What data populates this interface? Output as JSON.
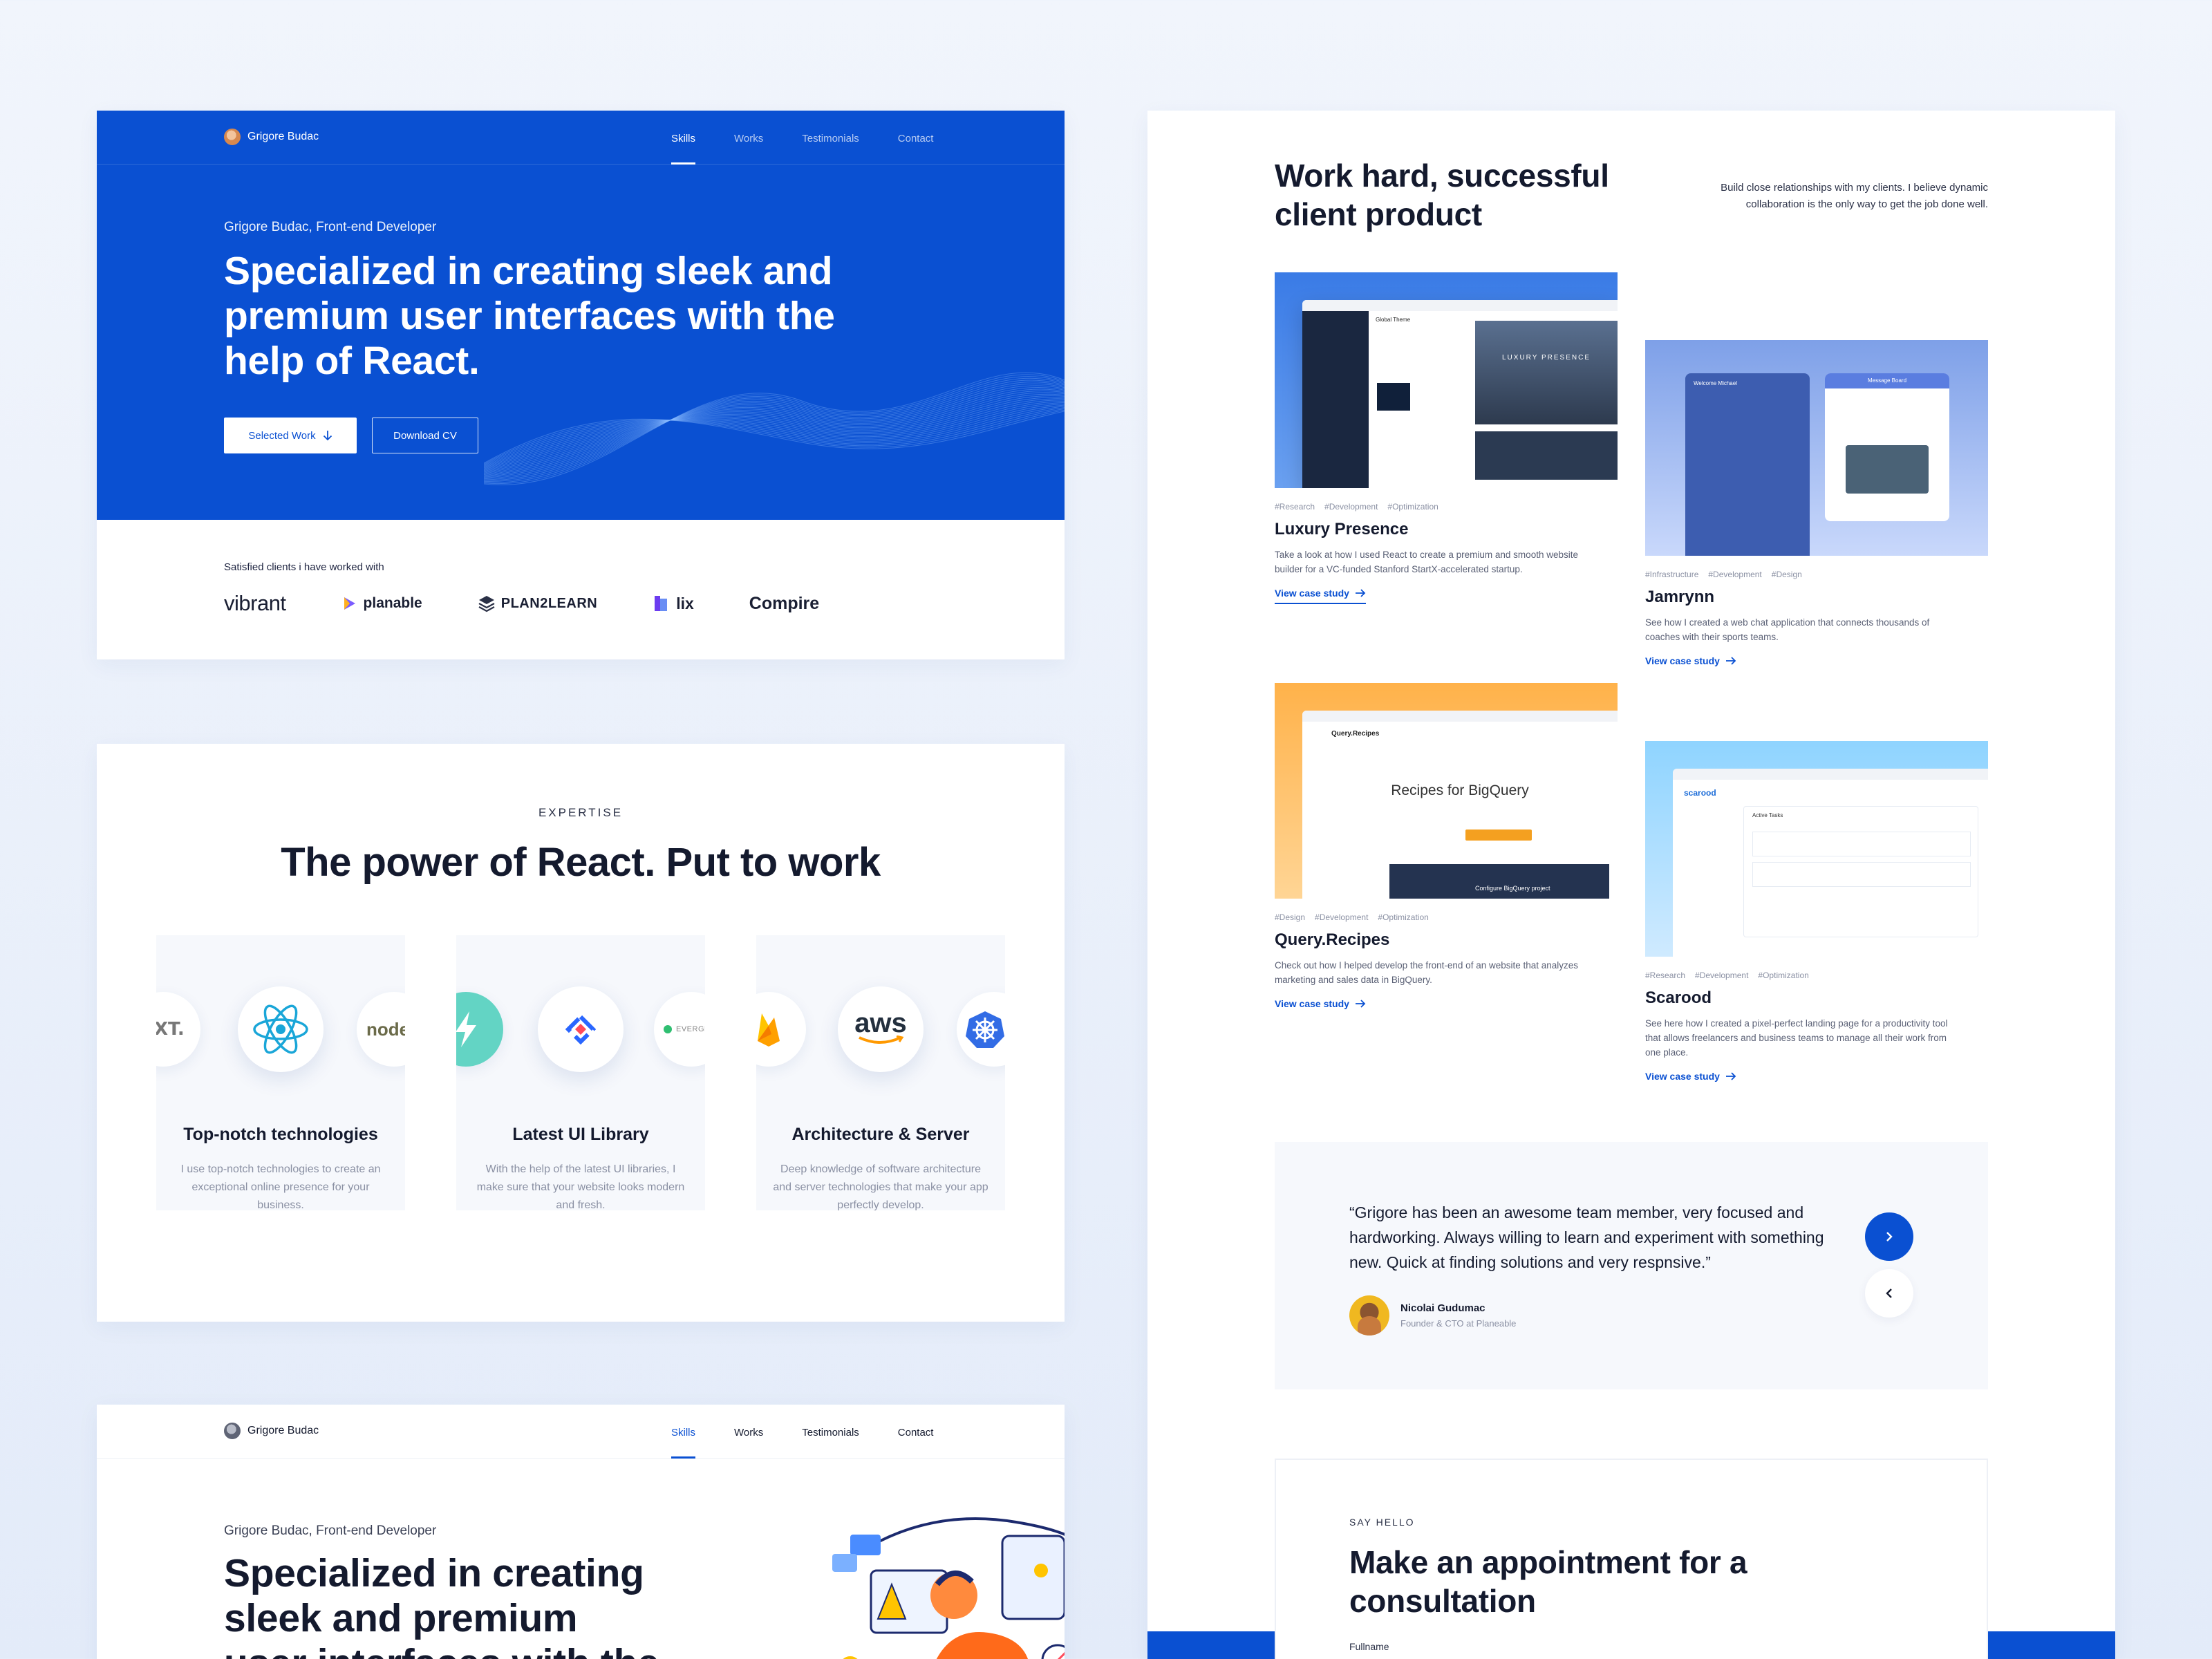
{
  "hero": {
    "brand": "Grigore Budac",
    "nav": [
      "Skills",
      "Works",
      "Testimonials",
      "Contact"
    ],
    "active_nav": "Skills",
    "subtitle": "Grigore Budac, Front-end Developer",
    "title": "Specialized in creating sleek and premium user interfaces with the help of React.",
    "btn_primary": "Selected Work",
    "btn_secondary": "Download CV",
    "clients_label": "Satisfied clients i have worked with",
    "clients": [
      "vibrant",
      "planable",
      "PLAN2LEARN",
      "lix",
      "Compire"
    ]
  },
  "expertise": {
    "eyebrow": "EXPERTISE",
    "title": "The power of React. Put to work",
    "items": [
      {
        "title": "Top-notch technologies",
        "text": "I use top-notch technologies to create an exceptional online presence for your business.",
        "icons": [
          "nextjs-icon",
          "react-icon",
          "nodejs-icon"
        ]
      },
      {
        "title": "Latest UI Library",
        "text": "With the help of the latest UI libraries, I make sure that your website looks modern and fresh.",
        "icons": [
          "bolt-icon",
          "jira-icon",
          "evergreen-icon"
        ]
      },
      {
        "title": "Architecture & Server",
        "text": "Deep knowledge of software architecture and server technologies that make your app perfectly develop.",
        "icons": [
          "firebase-icon",
          "aws-icon",
          "kubernetes-icon"
        ]
      }
    ],
    "icon_text": {
      "next": "EXT.",
      "node": "node",
      "evergreen": "EVERGRE",
      "aws": "aws"
    }
  },
  "hero2": {
    "brand": "Grigore Budac",
    "nav": [
      "Skills",
      "Works",
      "Testimonials",
      "Contact"
    ],
    "subtitle": "Grigore Budac, Front-end Developer",
    "title": "Specialized in creating sleek and premium user interfaces with the help of React."
  },
  "works": {
    "title": "Work hard, successful client product",
    "intro": "Build close relationships with my clients. I believe dynamic collaboration is the only way to get the job done well.",
    "cta": "View case study",
    "projects": [
      {
        "name": "Luxury Presence",
        "tags": [
          "#Research",
          "#Development",
          "#Optimization"
        ],
        "desc": "Take a look at how I used React to create a premium and smooth website builder for a VC-funded Stanford StartX-accelerated startup.",
        "screen_text": {
          "panel": "Global Theme",
          "hero": "LUXURY PRESENCE"
        }
      },
      {
        "name": "Jamrynn",
        "tags": [
          "#Infrastructure",
          "#Development",
          "#Design"
        ],
        "desc": "See how I created a web chat application that connects thousands of coaches with their sports teams.",
        "screen_text": {
          "left": "Welcome Michael",
          "right": "Message Board"
        }
      },
      {
        "name": "Query.Recipes",
        "tags": [
          "#Design",
          "#Development",
          "#Optimization"
        ],
        "desc": "Check out how I helped develop the front-end of an website that analyzes marketing and sales data in BigQuery.",
        "screen_text": {
          "logo": "Query.Recipes",
          "headline": "Recipes for BigQuery",
          "inner": "Configure BigQuery project"
        }
      },
      {
        "name": "Scarood",
        "tags": [
          "#Research",
          "#Development",
          "#Optimization"
        ],
        "desc": "See here how I created a pixel-perfect landing page for a productivity tool that allows freelancers and business teams to manage all their work from one place.",
        "screen_text": {
          "logo": "scarood",
          "panel": "Active Tasks"
        }
      }
    ],
    "testimonial": {
      "quote": "“Grigore has been an awesome team member, very focused and hardworking. Always willing to learn and experiment with something new. Quick at finding solutions and very respnsive.”",
      "author": "Nicolai Gudumac",
      "role": "Founder & CTO at Planeable"
    },
    "contact": {
      "eyebrow": "SAY HELLO",
      "title": "Make an appointment for a consultation",
      "field_label": "Fullname"
    }
  },
  "colors": {
    "accent": "#0a50d2",
    "text": "#141a2e",
    "muted": "#8a90a3",
    "panel": "#f6f8fc"
  }
}
